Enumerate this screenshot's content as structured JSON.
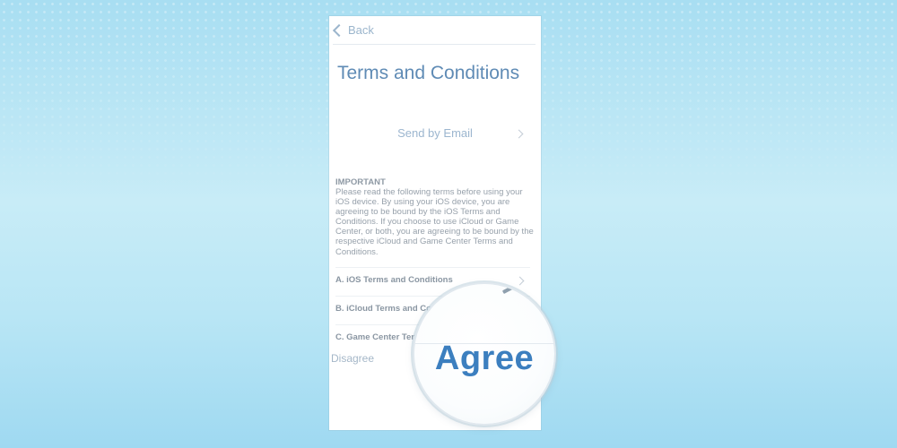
{
  "nav": {
    "back_label": "Back"
  },
  "page": {
    "title": "Terms and Conditions"
  },
  "send_email": {
    "label": "Send by Email"
  },
  "notice": {
    "heading": "IMPORTANT",
    "body": "Please read the following terms before using your iOS device. By using your iOS device, you are agreeing to be bound by the iOS Terms and Conditions. If you choose to use iCloud or Game Center, or both, you are agreeing to be bound by the respective iCloud and Game Center Terms and Conditions."
  },
  "terms": [
    {
      "label": "A. iOS Terms and Conditions"
    },
    {
      "label": "B. iCloud Terms and Co"
    },
    {
      "label": "C. Game Center Ter"
    }
  ],
  "actions": {
    "disagree": "Disagree",
    "agree": "Agree"
  },
  "colors": {
    "accent": "#3c7fbf",
    "title": "#5f8bb5",
    "muted": "#9cb6cf",
    "background": "#b9e6f5"
  },
  "icons": [
    "chevron-left-icon",
    "chevron-right-icon"
  ]
}
